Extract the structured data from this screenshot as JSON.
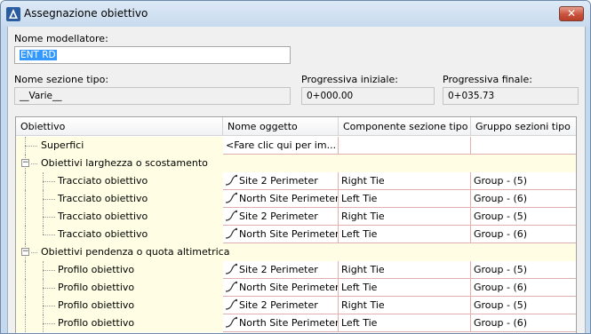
{
  "window": {
    "title": "Assegnazione obiettivo"
  },
  "fields": {
    "modeler_label": "Nome modellatore:",
    "modeler_value": "ENT RD",
    "section_label": "Nome sezione tipo:",
    "section_value": "__Varie__",
    "start_label": "Progressiva iniziale:",
    "start_value": "0+000.00",
    "end_label": "Progressiva finale:",
    "end_value": "0+035.73"
  },
  "grid": {
    "headers": [
      "Obiettivo",
      "Nome oggetto",
      "Componente sezione tipo",
      "Gruppo sezioni tipo"
    ],
    "rows": [
      {
        "label": "Superfici",
        "object": "<Fare clic qui per im...",
        "component": "",
        "group": ""
      },
      {
        "label": "Obiettivi larghezza o scostamento",
        "object": "",
        "component": "",
        "group": ""
      },
      {
        "label": "Tracciato obiettivo",
        "object": "Site 2 Perimeter",
        "component": "Right Tie",
        "group": "Group - (5)"
      },
      {
        "label": "Tracciato obiettivo",
        "object": "North Site Perimeter",
        "component": "Left Tie",
        "group": "Group - (6)"
      },
      {
        "label": "Tracciato obiettivo",
        "object": "Site 2 Perimeter",
        "component": "Right Tie",
        "group": "Group - (5)"
      },
      {
        "label": "Tracciato obiettivo",
        "object": "North Site Perimeter",
        "component": "Left Tie",
        "group": "Group - (6)"
      },
      {
        "label": "Obiettivi pendenza o quota altimetrica",
        "object": "",
        "component": "",
        "group": ""
      },
      {
        "label": "Profilo obiettivo",
        "object": "Site 2 Perimeter",
        "component": "Right Tie",
        "group": "Group - (5)"
      },
      {
        "label": "Profilo obiettivo",
        "object": "North Site Perimeter",
        "component": "Left Tie",
        "group": "Group - (6)"
      },
      {
        "label": "Profilo obiettivo",
        "object": "Site 2 Perimeter",
        "component": "Right Tie",
        "group": "Group - (5)"
      },
      {
        "label": "Profilo obiettivo",
        "object": "North Site Perimeter",
        "component": "Left Tie",
        "group": "Group - (6)"
      }
    ]
  },
  "tree_expander": "−",
  "close_glyph": "✕",
  "colors": {
    "selection": "#3399ff",
    "row_beige": "#fffee4",
    "grid_line": "#e0b0b0"
  }
}
